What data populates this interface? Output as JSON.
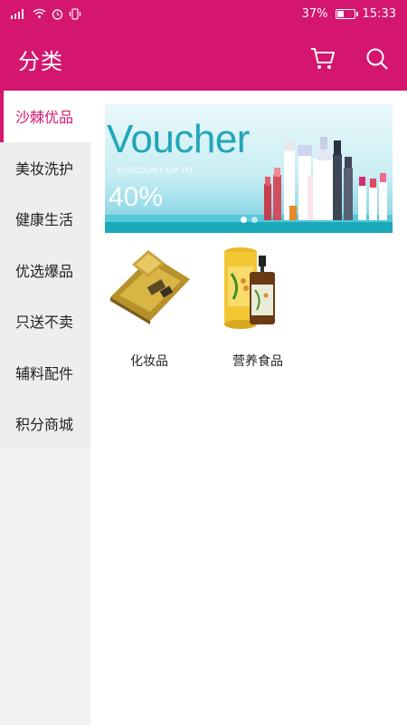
{
  "status": {
    "battery": "37%",
    "time": "15:33"
  },
  "header": {
    "title": "分类",
    "icons": [
      "cart-icon",
      "search-icon"
    ]
  },
  "sidebar": {
    "items": [
      {
        "label": "沙棘优品",
        "active": true
      },
      {
        "label": "美妆洗护",
        "active": false
      },
      {
        "label": "健康生活",
        "active": false
      },
      {
        "label": "优选爆品",
        "active": false
      },
      {
        "label": "只送不卖",
        "active": false
      },
      {
        "label": "辅料配件",
        "active": false
      },
      {
        "label": "积分商城",
        "active": false
      }
    ]
  },
  "banner": {
    "title": "Voucher",
    "subtitle": "DISCOUNT UP TO",
    "percent": "40%"
  },
  "categories": [
    {
      "label": "化妆品"
    },
    {
      "label": "营养食品"
    }
  ],
  "colors": {
    "accent": "#d4166f",
    "sidebar_bg": "#eeeeec"
  }
}
